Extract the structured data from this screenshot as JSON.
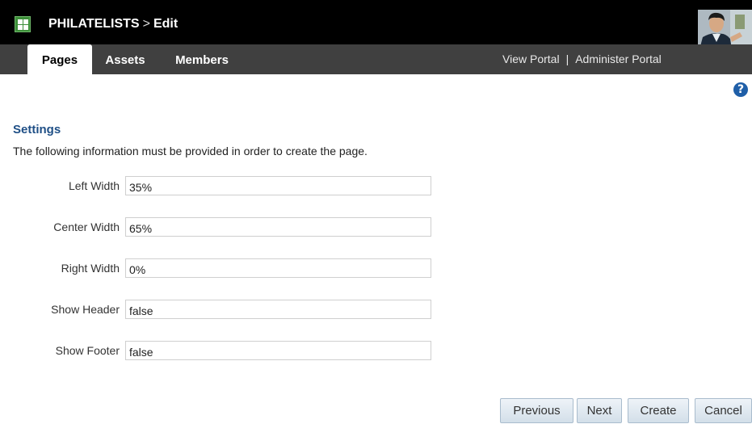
{
  "header": {
    "app_name": "PHILATELISTS",
    "separator": ">",
    "mode": "Edit"
  },
  "tabs": [
    {
      "label": "Pages",
      "active": true
    },
    {
      "label": "Assets",
      "active": false
    },
    {
      "label": "Members",
      "active": false
    }
  ],
  "top_links": {
    "view_portal": "View Portal",
    "divider": "|",
    "administer_portal": "Administer Portal"
  },
  "help": {
    "glyph": "?"
  },
  "settings": {
    "heading": "Settings",
    "description": "The following information must be provided in order to create the page.",
    "fields": [
      {
        "label": "Left Width",
        "value": "35%"
      },
      {
        "label": "Center Width",
        "value": "65%"
      },
      {
        "label": "Right Width",
        "value": "0%"
      },
      {
        "label": "Show Header",
        "value": "false"
      },
      {
        "label": "Show Footer",
        "value": "false"
      }
    ]
  },
  "buttons": {
    "previous": "Previous",
    "next": "Next",
    "create": "Create",
    "cancel": "Cancel"
  },
  "colors": {
    "header_bg": "#000000",
    "tabbar_bg": "#404040",
    "heading_text": "#1f4f86",
    "help_icon": "#1f5fa8",
    "logo_green": "#3d8f3a"
  }
}
